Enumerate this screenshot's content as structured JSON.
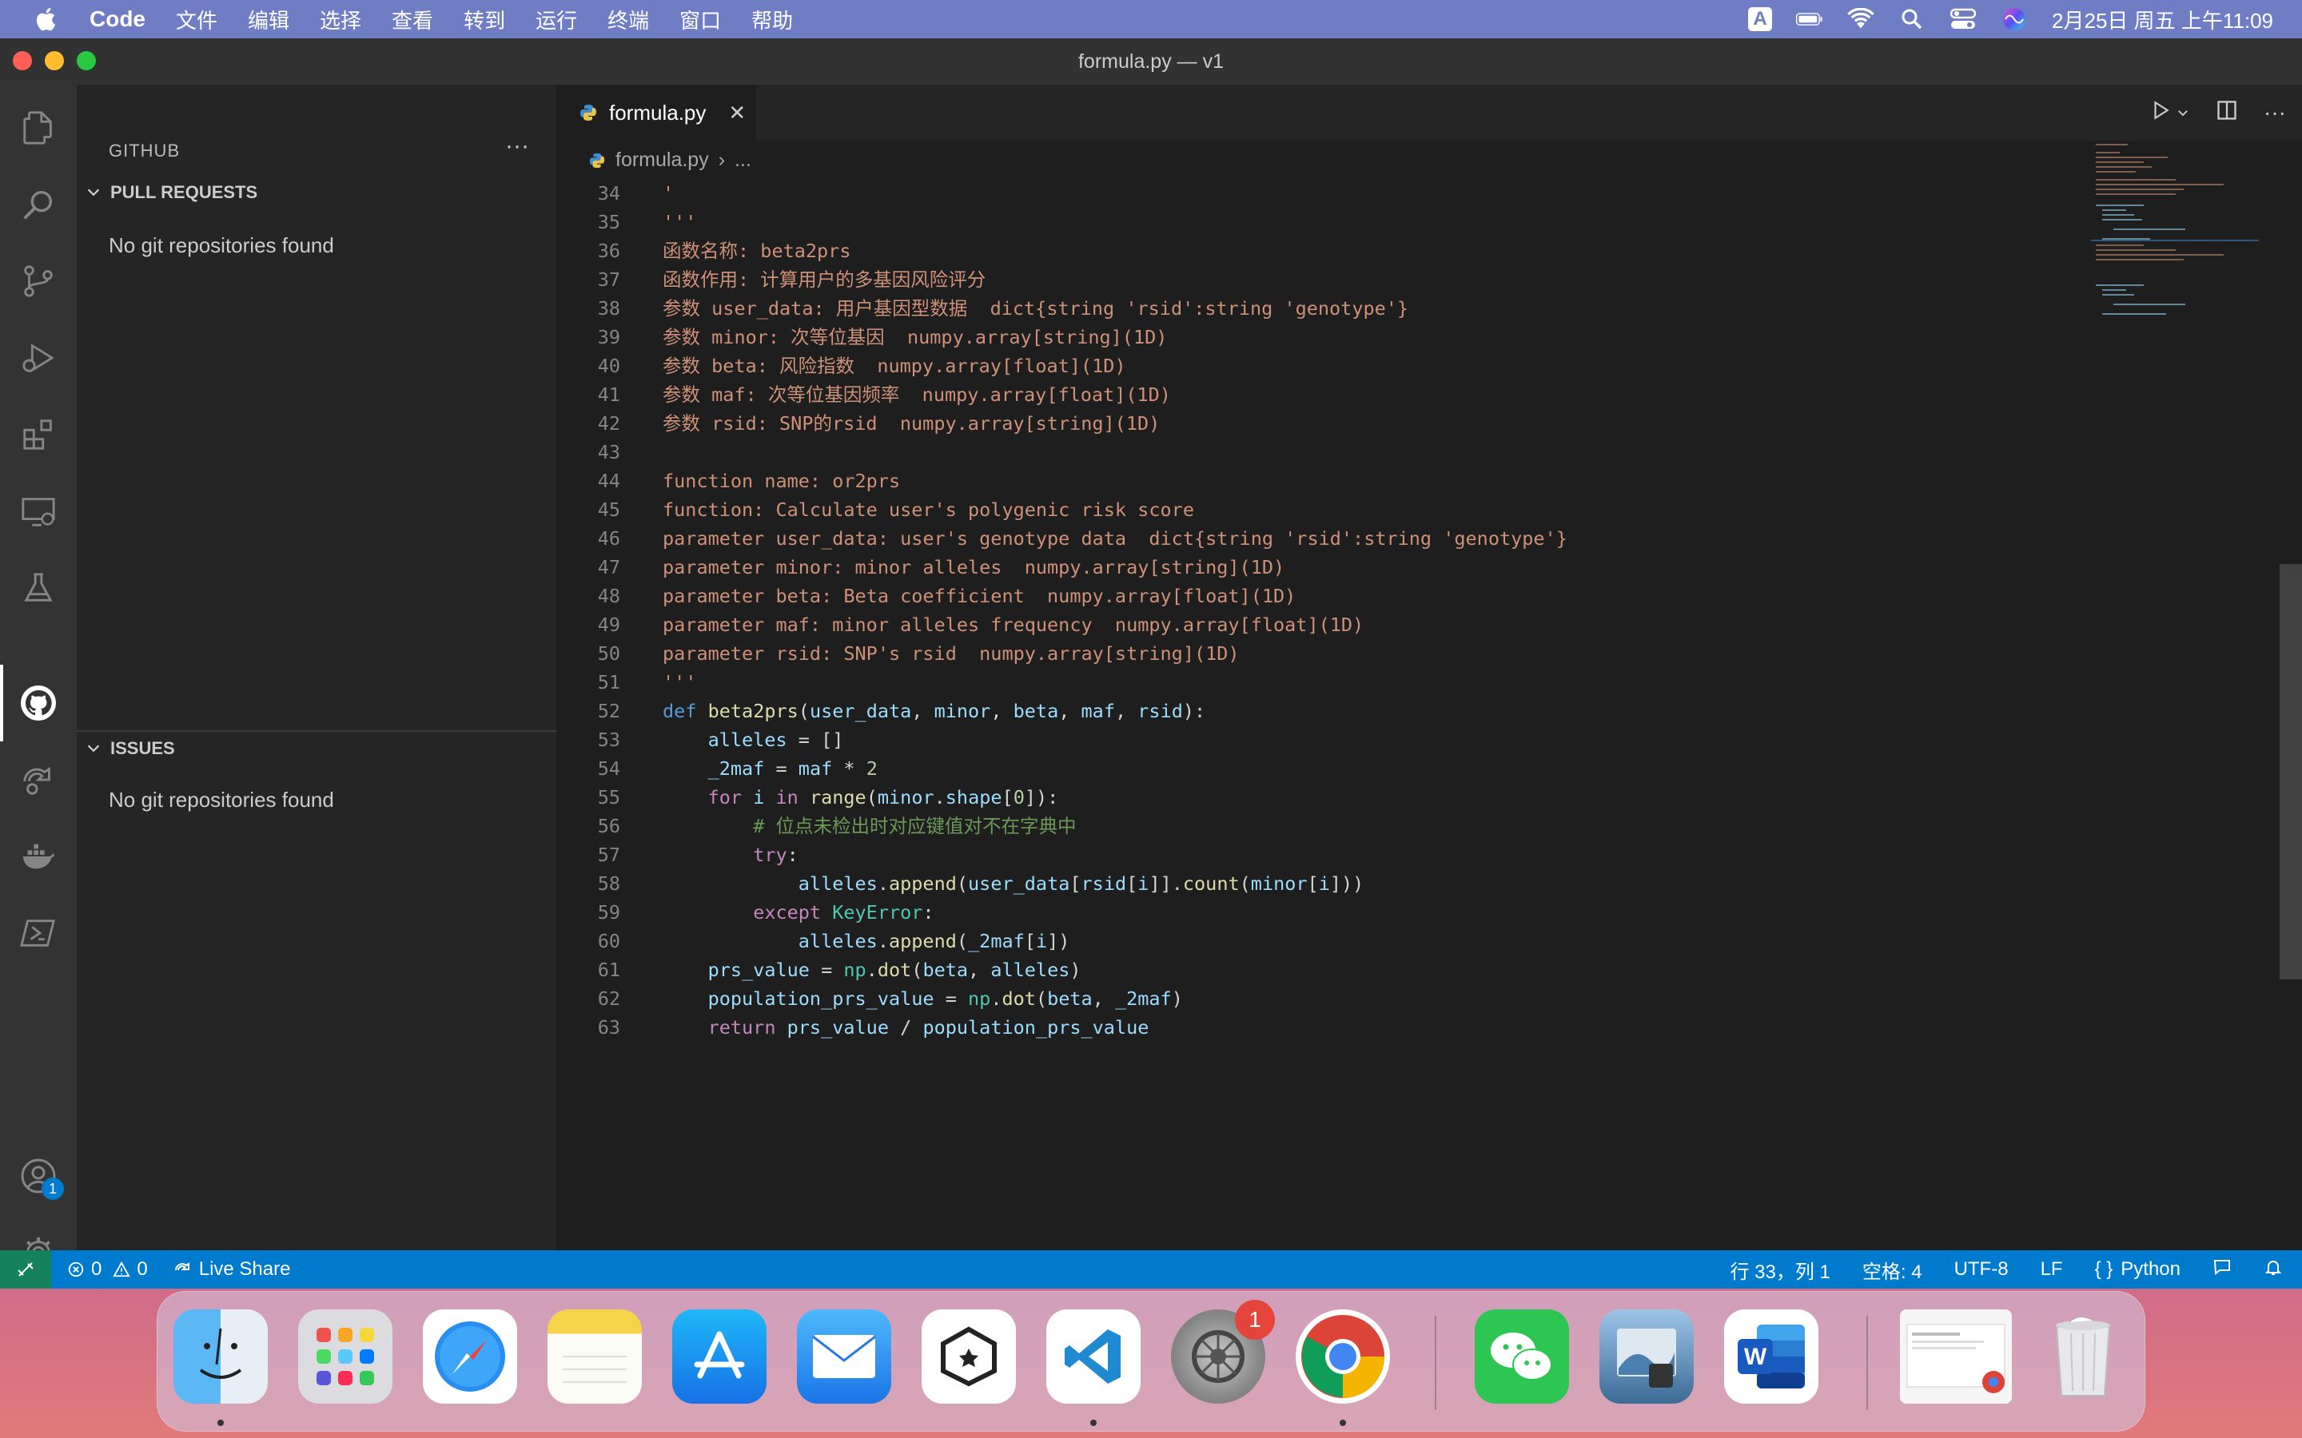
{
  "menubar": {
    "app_name": "Code",
    "items": [
      "文件",
      "编辑",
      "选择",
      "查看",
      "转到",
      "运行",
      "终端",
      "窗口",
      "帮助"
    ],
    "input_indicator": "A",
    "datetime": "2月25日 周五 上午11:09"
  },
  "window": {
    "title": "formula.py — v1"
  },
  "sidebar": {
    "header": "GITHUB",
    "pull_requests": {
      "title": "PULL REQUESTS",
      "message": "No git repositories found"
    },
    "issues": {
      "title": "ISSUES",
      "message": "No git repositories found"
    }
  },
  "activitybar": {
    "accounts_badge": "1"
  },
  "editor": {
    "tab_label": "formula.py",
    "breadcrumb_file": "formula.py",
    "breadcrumb_more": "..."
  },
  "code_lines": [
    {
      "n": "34",
      "html": "<span class=\"s\">'</span>"
    },
    {
      "n": "35",
      "html": "<span class=\"s\">'''</span>"
    },
    {
      "n": "36",
      "html": "<span class=\"s\">函数名称: beta2prs</span>"
    },
    {
      "n": "37",
      "html": "<span class=\"s\">函数作用: 计算用户的多基因风险评分</span>"
    },
    {
      "n": "38",
      "html": "<span class=\"s\">参数 user_data: 用户基因型数据  dict{string 'rsid':string 'genotype'}</span>"
    },
    {
      "n": "39",
      "html": "<span class=\"s\">参数 minor: 次等位基因  numpy.array[string](1D)</span>"
    },
    {
      "n": "40",
      "html": "<span class=\"s\">参数 beta: 风险指数  numpy.array[float](1D)</span>"
    },
    {
      "n": "41",
      "html": "<span class=\"s\">参数 maf: 次等位基因频率  numpy.array[float](1D)</span>"
    },
    {
      "n": "42",
      "html": "<span class=\"s\">参数 rsid: SNP的rsid  numpy.array[string](1D)</span>"
    },
    {
      "n": "43",
      "html": ""
    },
    {
      "n": "44",
      "html": "<span class=\"s\">function name: or2prs</span>"
    },
    {
      "n": "45",
      "html": "<span class=\"s\">function: Calculate user's polygenic risk score</span>"
    },
    {
      "n": "46",
      "html": "<span class=\"s\">parameter user_data: user's genotype data  dict{string 'rsid':string 'genotype'}</span>"
    },
    {
      "n": "47",
      "html": "<span class=\"s\">parameter minor: minor alleles  numpy.array[string](1D)</span>"
    },
    {
      "n": "48",
      "html": "<span class=\"s\">parameter beta: Beta coefficient  numpy.array[float](1D)</span>"
    },
    {
      "n": "49",
      "html": "<span class=\"s\">parameter maf: minor alleles frequency  numpy.array[float](1D)</span>"
    },
    {
      "n": "50",
      "html": "<span class=\"s\">parameter rsid: SNP's rsid  numpy.array[string](1D)</span>"
    },
    {
      "n": "51",
      "html": "<span class=\"s\">'''</span>"
    },
    {
      "n": "52",
      "html": "<span class=\"kw\">def</span> <span class=\"fn\">beta2prs</span><span class=\"op\">(</span><span class=\"var\">user_data</span><span class=\"op\">, </span><span class=\"var\">minor</span><span class=\"op\">, </span><span class=\"var\">beta</span><span class=\"op\">, </span><span class=\"var\">maf</span><span class=\"op\">, </span><span class=\"var\">rsid</span><span class=\"op\">):</span>"
    },
    {
      "n": "53",
      "html": "    <span class=\"var\">alleles</span><span class=\"op\"> = []</span>"
    },
    {
      "n": "54",
      "html": "    <span class=\"var\">_2maf</span><span class=\"op\"> = </span><span class=\"var\">maf</span><span class=\"op\"> * </span><span class=\"num\">2</span>"
    },
    {
      "n": "55",
      "html": "    <span class=\"ctl\">for</span> <span class=\"var\">i</span> <span class=\"ctl\">in</span> <span class=\"fn\">range</span><span class=\"op\">(</span><span class=\"var\">minor</span><span class=\"op\">.</span><span class=\"var\">shape</span><span class=\"op\">[</span><span class=\"num\">0</span><span class=\"op\">]):</span>"
    },
    {
      "n": "56",
      "html": "        <span class=\"cm\"># 位点未检出时对应键值对不在字典中</span>"
    },
    {
      "n": "57",
      "html": "        <span class=\"ctl\">try</span><span class=\"op\">:</span>"
    },
    {
      "n": "58",
      "html": "            <span class=\"var\">alleles</span><span class=\"op\">.</span><span class=\"fn\">append</span><span class=\"op\">(</span><span class=\"var\">user_data</span><span class=\"op\">[</span><span class=\"var\">rsid</span><span class=\"op\">[</span><span class=\"var\">i</span><span class=\"op\">]].</span><span class=\"fn\">count</span><span class=\"op\">(</span><span class=\"var\">minor</span><span class=\"op\">[</span><span class=\"var\">i</span><span class=\"op\">]))</span>"
    },
    {
      "n": "59",
      "html": "        <span class=\"ctl\">except</span> <span class=\"cls\">KeyError</span><span class=\"op\">:</span>"
    },
    {
      "n": "60",
      "html": "            <span class=\"var\">alleles</span><span class=\"op\">.</span><span class=\"fn\">append</span><span class=\"op\">(</span><span class=\"var\">_2maf</span><span class=\"op\">[</span><span class=\"var\">i</span><span class=\"op\">])</span>"
    },
    {
      "n": "61",
      "html": "    <span class=\"var\">prs_value</span><span class=\"op\"> = </span><span class=\"cls\">np</span><span class=\"op\">.</span><span class=\"fn\">dot</span><span class=\"op\">(</span><span class=\"var\">beta</span><span class=\"op\">, </span><span class=\"var\">alleles</span><span class=\"op\">)</span>"
    },
    {
      "n": "62",
      "html": "    <span class=\"var\">population_prs_value</span><span class=\"op\"> = </span><span class=\"cls\">np</span><span class=\"op\">.</span><span class=\"fn\">dot</span><span class=\"op\">(</span><span class=\"var\">beta</span><span class=\"op\">, </span><span class=\"var\">_2maf</span><span class=\"op\">)</span>"
    },
    {
      "n": "63",
      "html": "    <span class=\"ctl\">return</span> <span class=\"var\">prs_value</span><span class=\"op\"> / </span><span class=\"var\">population_prs_value</span>"
    }
  ],
  "statusbar": {
    "errors": "0",
    "warnings": "0",
    "live_share": "Live Share",
    "cursor": "行 33，列 1",
    "spaces": "空格: 4",
    "encoding": "UTF-8",
    "eol": "LF",
    "language": "Python"
  },
  "dock": {
    "system_prefs_badge": "1"
  }
}
